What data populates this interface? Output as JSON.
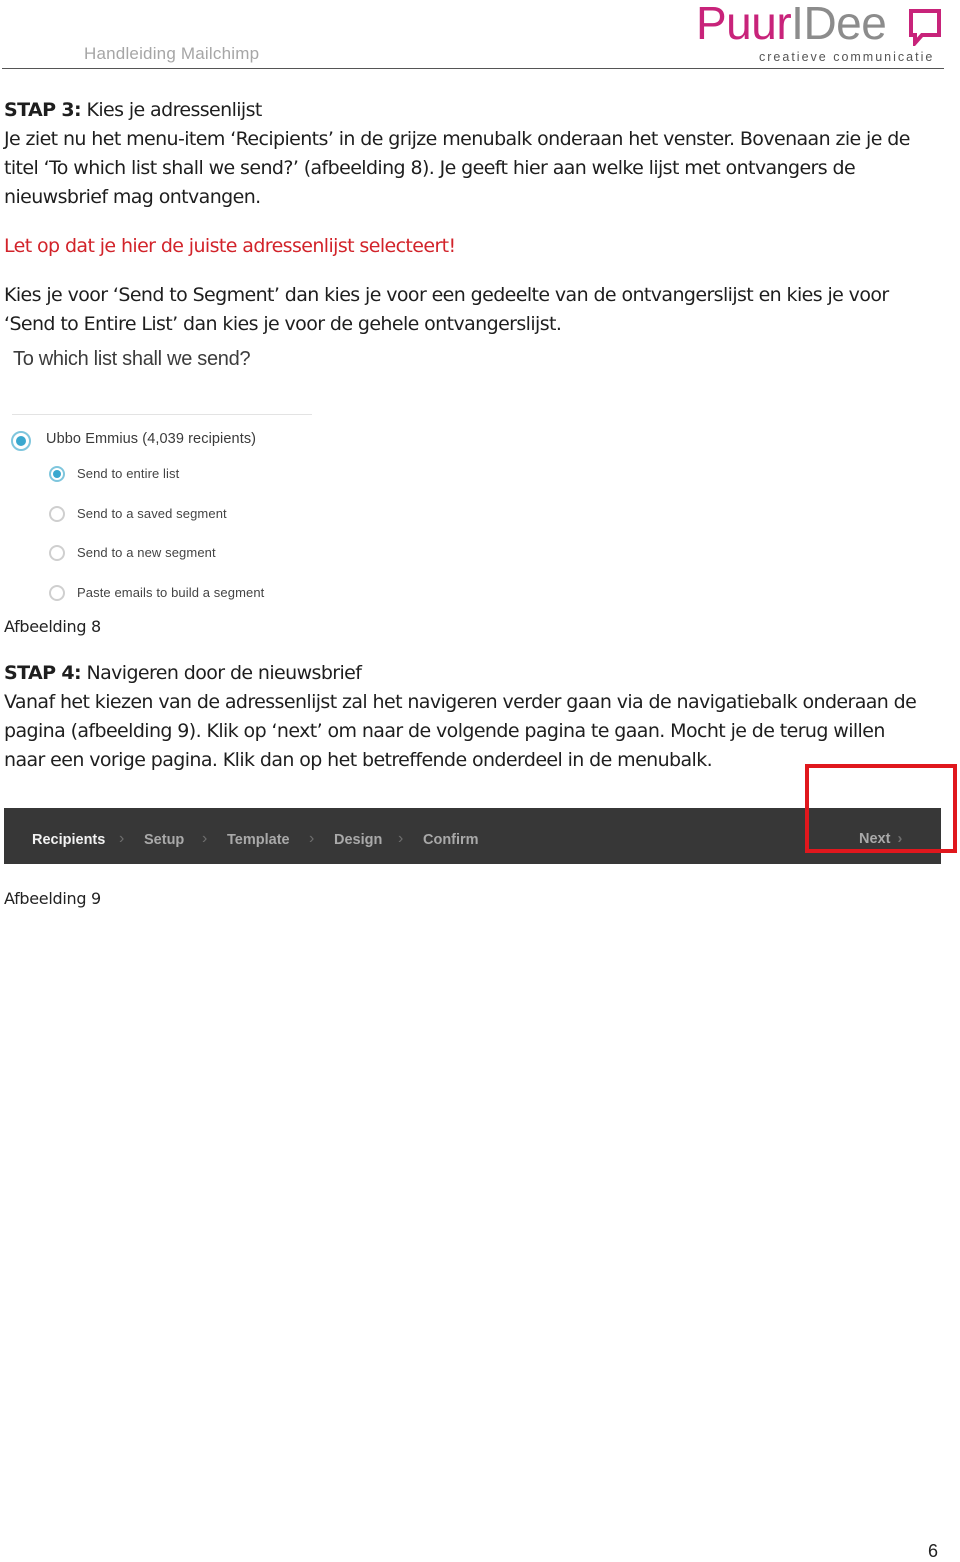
{
  "header": {
    "title": "Handleiding Mailchimp",
    "logo": {
      "brand_part1": "Puur",
      "brand_part2": "IDee",
      "tagline": "creatieve communicatie",
      "brand_color": "#c8237a",
      "gray_color": "#8c8c8c"
    }
  },
  "step3": {
    "label": "STAP 3:",
    "title": " Kies je adressenlijst",
    "paragraph_lines": [
      "Je ziet nu het menu-item ‘Recipients’ in de grijze menubalk onderaan het venster. Bovenaan zie je de",
      "titel ‘To which list shall we send?’ (afbeelding 8). Je geeft hier aan welke lijst met ontvangers de",
      "nieuwsbrief mag ontvangen."
    ],
    "warning": "Let op dat je hier de juiste adressenlijst selecteert!",
    "explanation_lines": [
      "Kies je voor ‘Send to Segment’ dan kies je voor een gedeelte van de ontvangerslijst en kies je voor",
      "‘Send to Entire List’ dan kies je voor de gehele ontvangerslijst."
    ]
  },
  "figure8": {
    "title": "To which list shall we send?",
    "list_option": {
      "label": "Ubbo Emmius (4,039 recipients)",
      "selected": true
    },
    "sub_options": [
      {
        "label": "Send to entire list",
        "selected": true
      },
      {
        "label": "Send to a saved segment",
        "selected": false
      },
      {
        "label": "Send to a new segment",
        "selected": false
      },
      {
        "label": "Paste emails to build a segment",
        "selected": false
      }
    ],
    "caption": "Afbeelding 8",
    "accent_color": "#3aa8cf"
  },
  "step4": {
    "label": "STAP 4:",
    "title": " Navigeren door de nieuwsbrief",
    "paragraph_lines": [
      "Vanaf het kiezen van de adressenlijst zal het navigeren verder gaan via de navigatiebalk onderaan de",
      "pagina (afbeelding 9). Klik op ‘next’ om naar de volgende pagina te gaan. Mocht je de terug willen",
      "naar een vorige pagina. Klik dan op het betreffende onderdeel in de menubalk."
    ]
  },
  "figure9": {
    "nav_items": [
      {
        "label": "Recipients",
        "active": true
      },
      {
        "label": "Setup",
        "active": false
      },
      {
        "label": "Template",
        "active": false
      },
      {
        "label": "Design",
        "active": false
      },
      {
        "label": "Confirm",
        "active": false
      }
    ],
    "separator": "›",
    "next_label": "Next",
    "next_chevron": "›",
    "caption": "Afbeelding 9",
    "bar_color": "#373737",
    "highlight_color": "#e0171d"
  },
  "footer": {
    "page_number": "6"
  }
}
